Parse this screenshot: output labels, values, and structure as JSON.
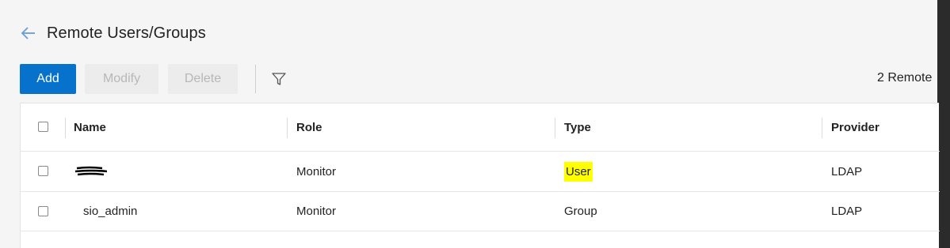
{
  "header": {
    "title": "Remote Users/Groups",
    "back_icon": "arrow-left-icon"
  },
  "toolbar": {
    "add_label": "Add",
    "modify_label": "Modify",
    "delete_label": "Delete",
    "filter_icon": "filter-icon",
    "count_text": "2 Remote"
  },
  "colors": {
    "accent": "#0672cb",
    "highlight": "#ffff00",
    "disabled_text": "#b7b7b7"
  },
  "table": {
    "columns": [
      "Name",
      "Role",
      "Type",
      "Provider"
    ],
    "rows": [
      {
        "name": "",
        "role": "Monitor",
        "type": "User",
        "provider": "LDAP"
      },
      {
        "name": "sio_admin",
        "role": "Monitor",
        "type": "Group",
        "provider": "LDAP"
      }
    ]
  }
}
